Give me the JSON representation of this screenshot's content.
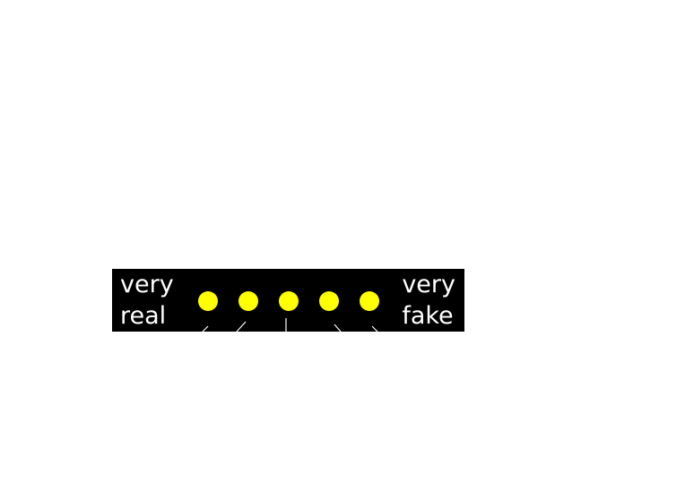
{
  "scale": {
    "left_label": [
      "very",
      "real"
    ],
    "right_label": [
      "very",
      "fake"
    ],
    "dot_count": 5,
    "dot_color": "#ffff00",
    "background_color": "#000000",
    "line_color": "#ffffff"
  }
}
